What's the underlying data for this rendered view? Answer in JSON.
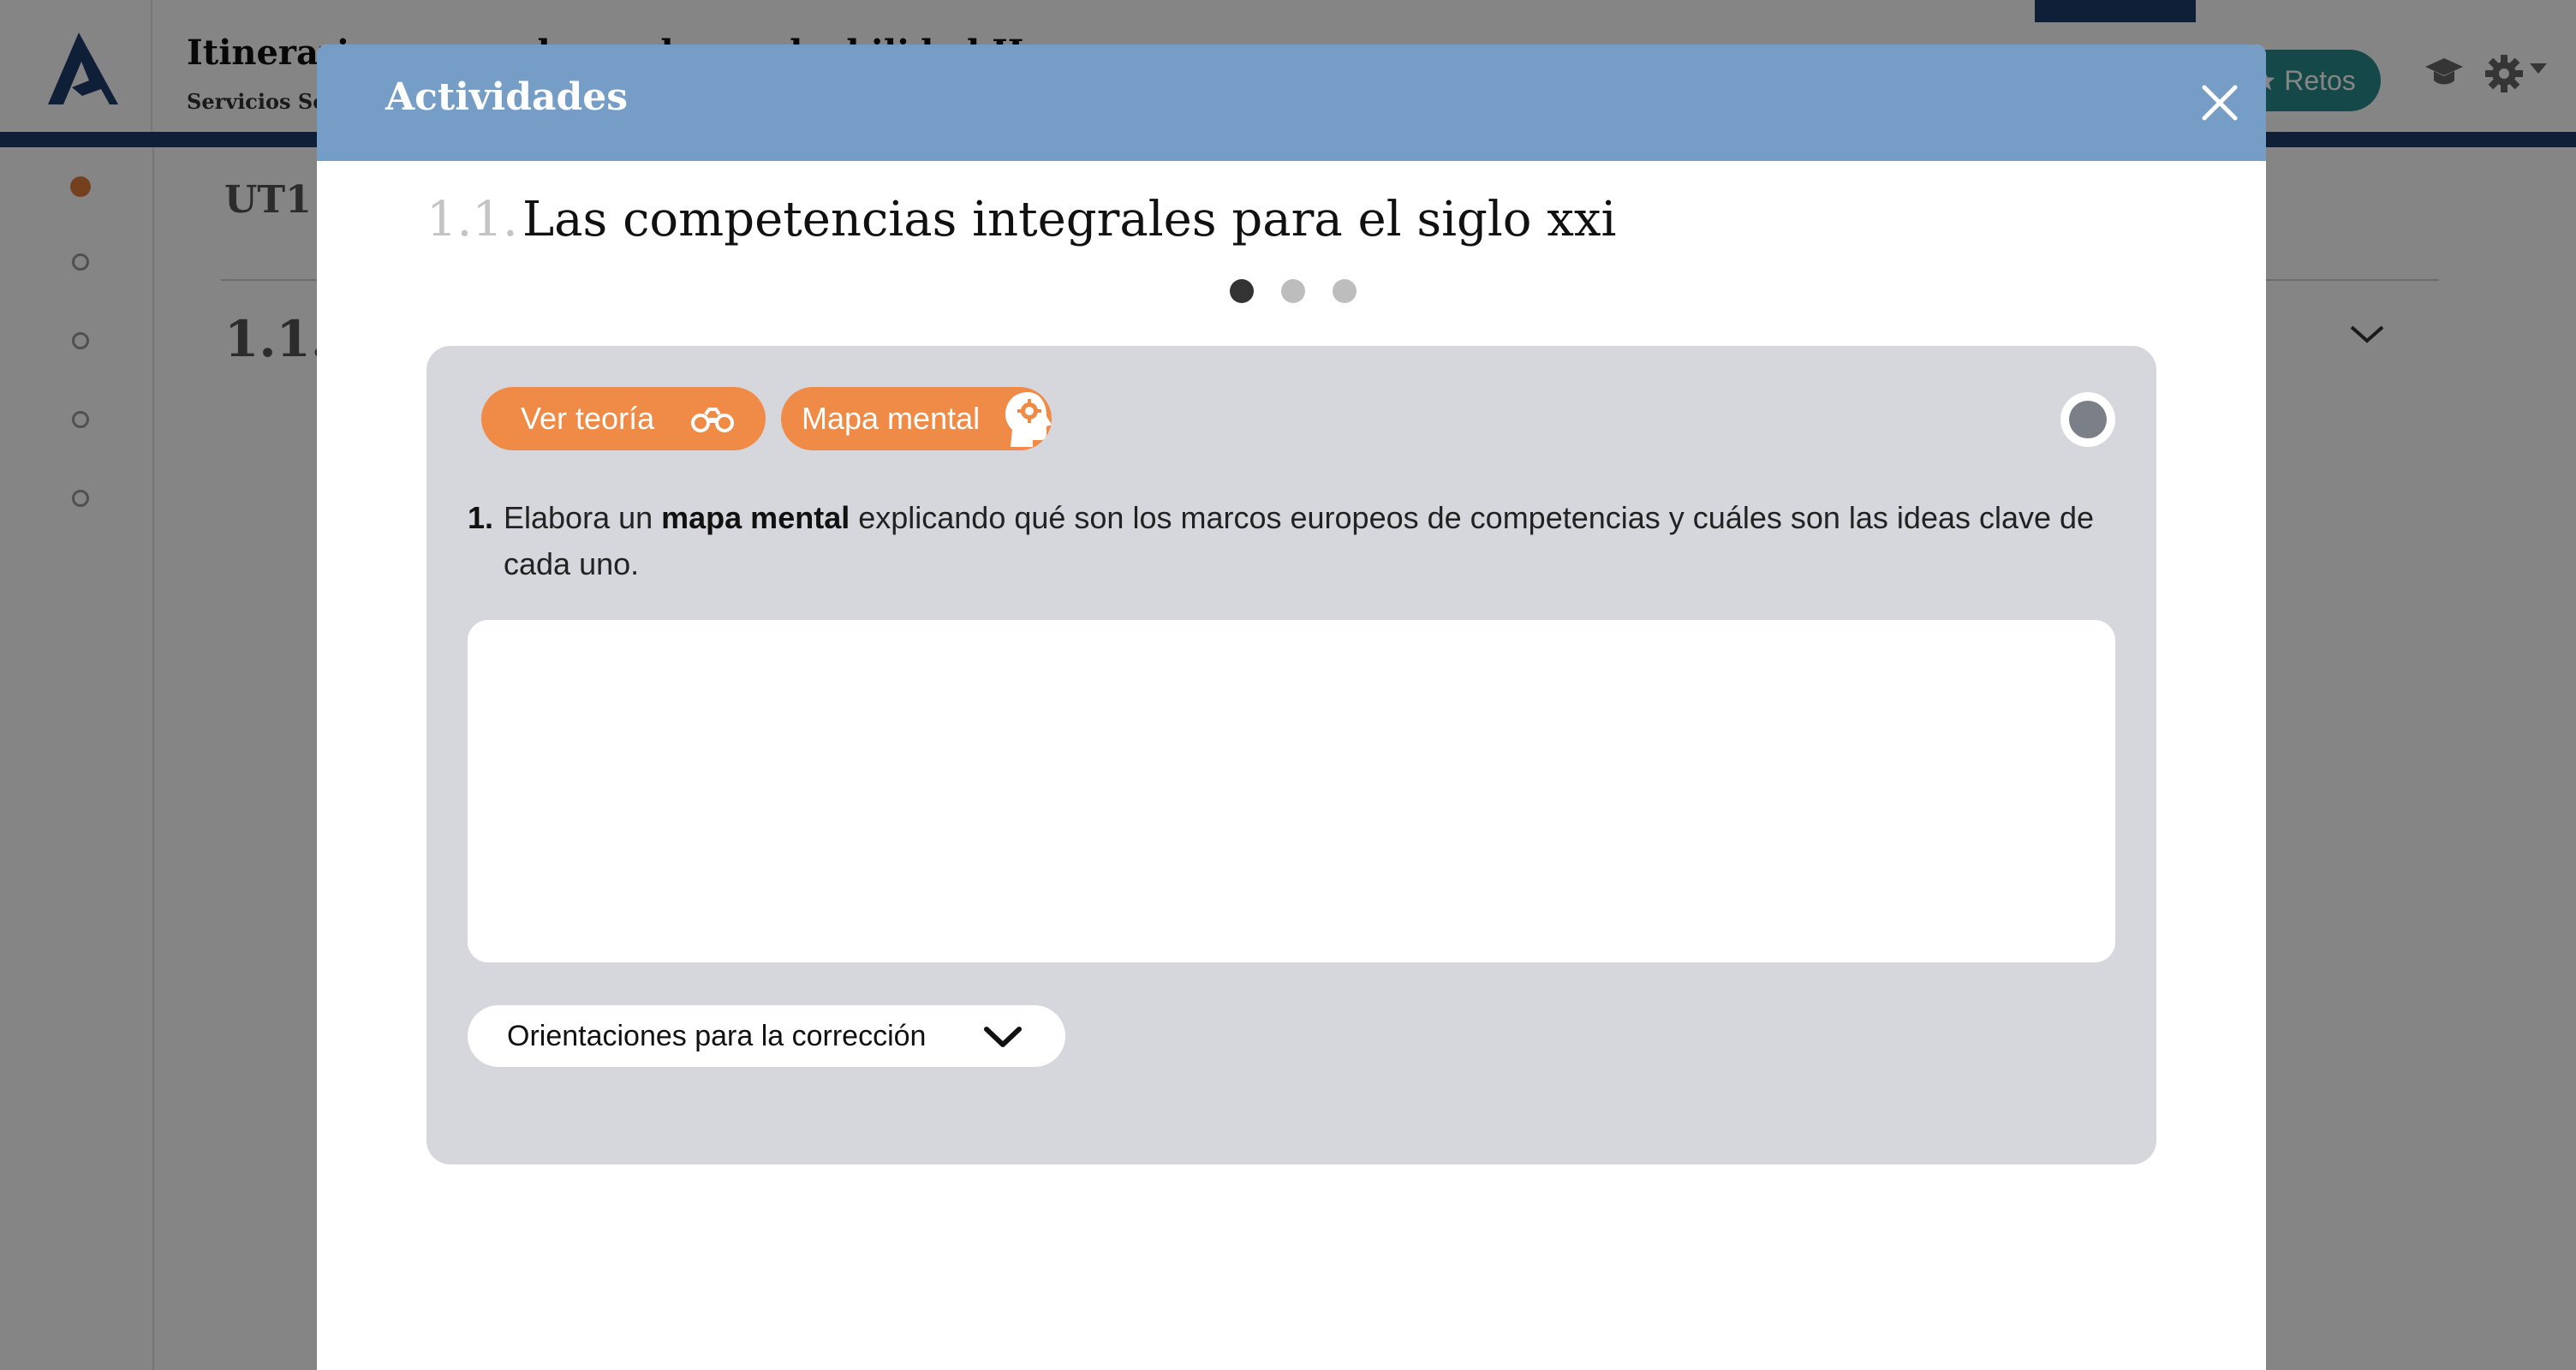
{
  "app": {
    "course_title": "Itinerario personal para la empleabilidad II",
    "course_subtitle": "Servicios Socioculturales y a la Comunidad",
    "retos_label": "Retos",
    "unit_label": "UT1",
    "section_number": "1.1.",
    "colors": {
      "header_bar": "#1f3d6b",
      "retos": "#2a8a8a",
      "active_dot": "#e07b39"
    }
  },
  "modal": {
    "title": "Actividades",
    "activity": {
      "number": "1.1.",
      "title": "Las competencias integrales para el siglo xxi"
    },
    "pager": {
      "total": 3,
      "current": 1
    },
    "buttons": {
      "theory": "Ver teoría",
      "mind_map": "Mapa mental",
      "orientations": "Orientaciones para la corrección"
    },
    "question": {
      "number": "1.",
      "text_before": "Elabora un ",
      "text_bold": "mapa mental",
      "text_after": " explicando qué son los marcos europeos de competencias y cuáles son las ideas clave de cada uno."
    },
    "answer": {
      "value": "",
      "placeholder": ""
    },
    "colors": {
      "header": "#759dc5",
      "card": "#d6d7dc",
      "pill": "#ef8b47"
    },
    "icons": {
      "close": "close-icon",
      "theory": "binoculars-icon",
      "mind_map": "head-gear-icon",
      "orientations": "chevron-down-icon"
    }
  }
}
